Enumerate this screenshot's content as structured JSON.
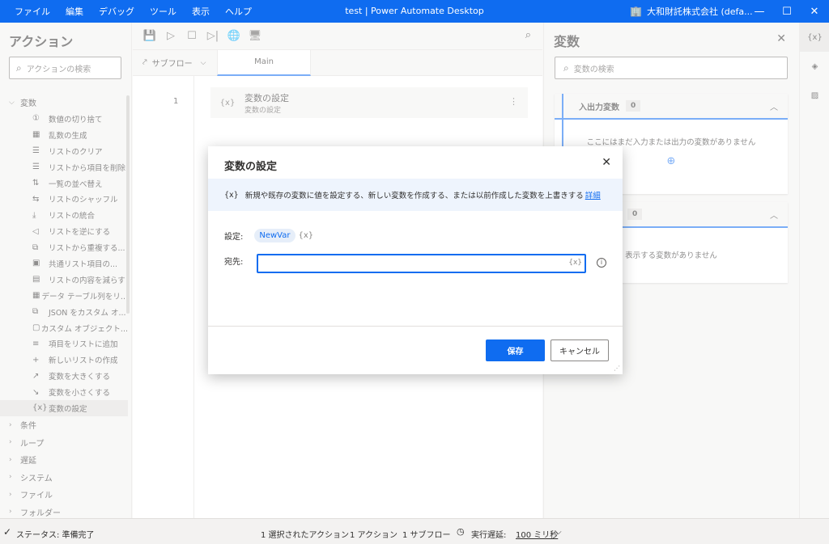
{
  "menu": [
    "ファイル",
    "編集",
    "デバッグ",
    "ツール",
    "表示",
    "ヘルプ"
  ],
  "window_title": "test | Power Automate Desktop",
  "account": "大和財託株式会社 (defa...",
  "window_controls": {
    "minimize": "—",
    "maximize": "☐",
    "close": "✕"
  },
  "actions_panel": {
    "title": "アクション",
    "search_placeholder": "アクションの検索",
    "category_open": "変数",
    "items": [
      {
        "icon": "①",
        "label": "数値の切り捨て"
      },
      {
        "icon": "▦",
        "label": "乱数の生成"
      },
      {
        "icon": "☰",
        "label": "リストのクリア"
      },
      {
        "icon": "☰",
        "label": "リストから項目を削除"
      },
      {
        "icon": "⇅",
        "label": "一覧の並べ替え"
      },
      {
        "icon": "⇆",
        "label": "リストのシャッフル"
      },
      {
        "icon": "⤓",
        "label": "リストの統合"
      },
      {
        "icon": "◁",
        "label": "リストを逆にする"
      },
      {
        "icon": "⧉",
        "label": "リストから重複する..."
      },
      {
        "icon": "▣",
        "label": "共通リスト項目の..."
      },
      {
        "icon": "▤",
        "label": "リストの内容を減らす"
      },
      {
        "icon": "▦",
        "label": "データ テーブル列をリ..."
      },
      {
        "icon": "⧉",
        "label": "JSON をカスタム オ..."
      },
      {
        "icon": "▢",
        "label": "カスタム オブジェクト..."
      },
      {
        "icon": "≡",
        "label": "項目をリストに追加"
      },
      {
        "icon": "+",
        "label": "新しいリストの作成"
      },
      {
        "icon": "↗",
        "label": "変数を大きくする"
      },
      {
        "icon": "↘",
        "label": "変数を小さくする"
      },
      {
        "icon": "{x}",
        "label": "変数の設定"
      }
    ],
    "categories_closed": [
      "条件",
      "ループ",
      "遅延",
      "システム",
      "ファイル",
      "フォルダー"
    ]
  },
  "designer": {
    "subflow_label": "サブフロー",
    "tab_main": "Main",
    "line_number": "1",
    "step_icon": "{x}",
    "step_title": "変数の設定",
    "step_subtitle": "変数の設定",
    "step_more": "⋮"
  },
  "variables_panel": {
    "title": "変数",
    "search_placeholder": "変数の検索",
    "io_section_title": "入出力変数",
    "io_count": "0",
    "io_empty": "ここにはまだ入力または出力の変数がありません",
    "flow_count": "0",
    "flow_empty": "表示する変数がありません"
  },
  "rail": [
    "{x}",
    "◈",
    "▨"
  ],
  "dialog": {
    "title": "変数の設定",
    "info_icon": "{x}",
    "info_text": "新規や既存の変数に値を設定する、新しい変数を作成する、または以前作成した変数を上書きする",
    "info_link": "詳細",
    "set_label": "設定:",
    "set_value": "NewVar",
    "var_symbol": "{x}",
    "target_label": "宛先:",
    "target_value": "",
    "save_label": "保存",
    "cancel_label": "キャンセル"
  },
  "status": {
    "state": "ステータス: 準備完了",
    "selected_actions": "1 選択されたアクション",
    "actions": "1 アクション",
    "subflows": "1 サブフロー",
    "delay_label": "実行遅延:",
    "delay_value": "100 ミリ秒"
  },
  "colors": {
    "accent": "#0f6cf0",
    "panel": "#f3f2f1"
  }
}
